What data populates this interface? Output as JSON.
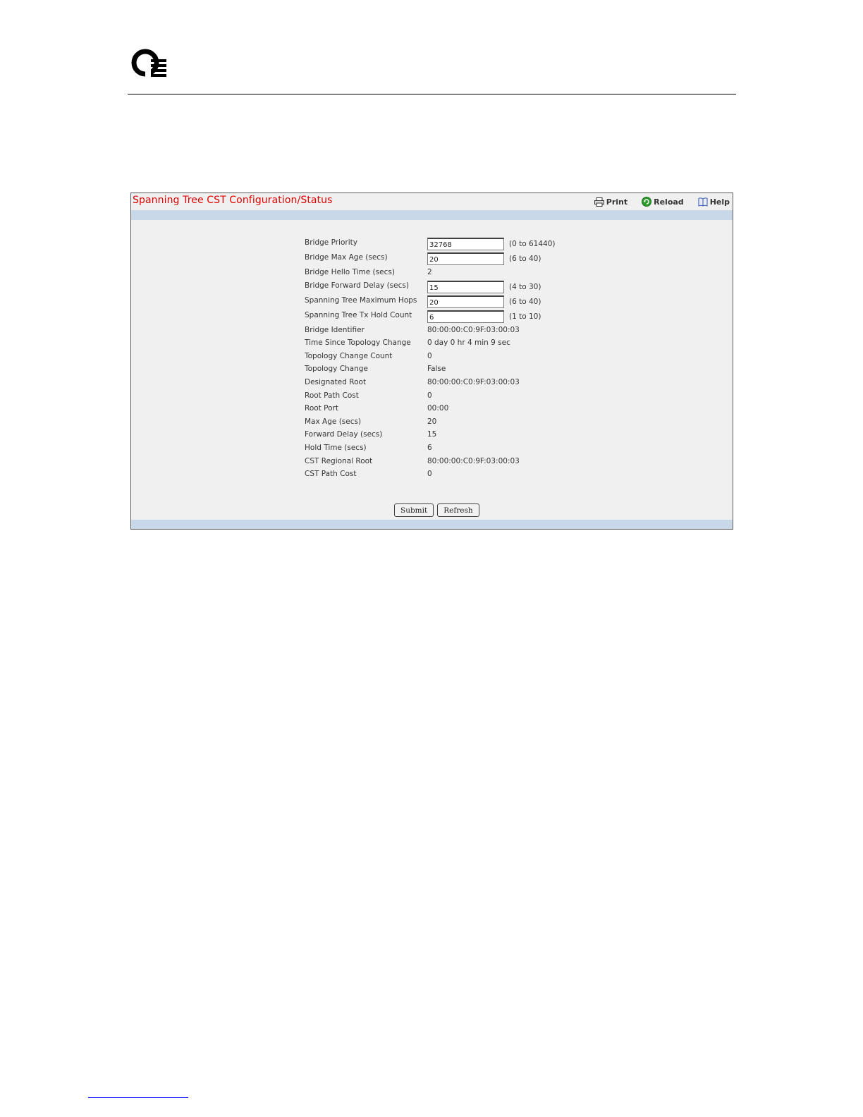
{
  "panel": {
    "title": "Spanning Tree CST Configuration/Status",
    "toolbar": {
      "print_label": "Print",
      "reload_label": "Reload",
      "help_label": "Help"
    }
  },
  "form": {
    "inputs": [
      {
        "label": "Bridge Priority",
        "value": "32768",
        "range": "(0 to 61440)"
      },
      {
        "label": "Bridge Max Age (secs)",
        "value": "20",
        "range": "(6 to 40)"
      }
    ],
    "hello_time": {
      "label": "Bridge Hello Time (secs)",
      "value": "2"
    },
    "inputs2": [
      {
        "label": "Bridge Forward Delay (secs)",
        "value": "15",
        "range": "(4 to 30)"
      },
      {
        "label": "Spanning Tree Maximum Hops",
        "value": "20",
        "range": "(6 to 40)"
      },
      {
        "label": "Spanning Tree Tx Hold Count",
        "value": "6",
        "range": "(1 to 10)"
      }
    ],
    "status": [
      {
        "label": "Bridge Identifier",
        "value": "80:00:00:C0:9F:03:00:03"
      },
      {
        "label": "Time Since Topology Change",
        "value": "0 day 0 hr 4 min 9 sec"
      },
      {
        "label": "Topology Change Count",
        "value": "0"
      },
      {
        "label": "Topology Change",
        "value": "False"
      },
      {
        "label": "Designated Root",
        "value": "80:00:00:C0:9F:03:00:03"
      },
      {
        "label": "Root Path Cost",
        "value": "0"
      },
      {
        "label": "Root Port",
        "value": "00:00"
      },
      {
        "label": "Max Age (secs)",
        "value": "20"
      },
      {
        "label": "Forward Delay (secs)",
        "value": "15"
      },
      {
        "label": "Hold Time (secs)",
        "value": "6"
      },
      {
        "label": "CST Regional Root",
        "value": "80:00:00:C0:9F:03:00:03"
      },
      {
        "label": "CST Path Cost",
        "value": "0"
      }
    ]
  },
  "buttons": {
    "submit_label": "Submit",
    "refresh_label": "Refresh"
  },
  "colors": {
    "title": "#e00000",
    "band": "#c8d8e8",
    "panel_bg": "#f0f0f0"
  }
}
